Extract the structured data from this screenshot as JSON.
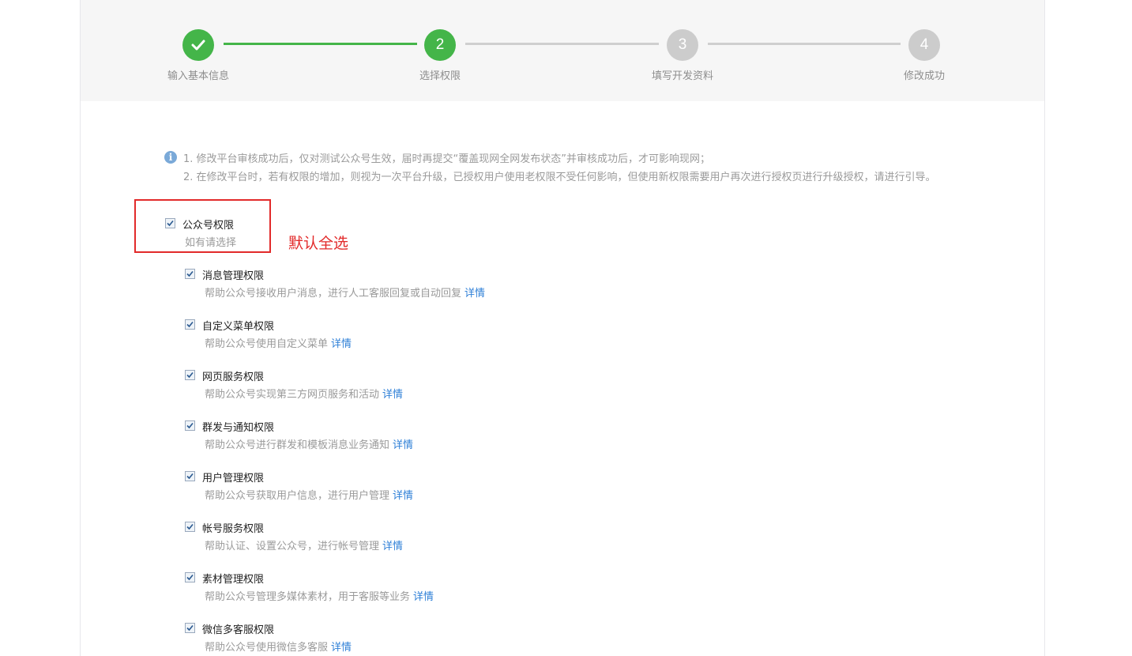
{
  "steps": [
    {
      "number": "1",
      "label": "输入基本信息",
      "state": "done"
    },
    {
      "number": "2",
      "label": "选择权限",
      "state": "current"
    },
    {
      "number": "3",
      "label": "填写开发资料",
      "state": "pending"
    },
    {
      "number": "4",
      "label": "修改成功",
      "state": "pending"
    }
  ],
  "notice": {
    "line1": "1. 修改平台审核成功后，仅对测试公众号生效，届时再提交“覆盖现网全网发布状态”并审核成功后，才可影响现网；",
    "line2": "2. 在修改平台时，若有权限的增加，则视为一次平台升级，已授权用户使用老权限不受任何影响，但使用新权限需要用户再次进行授权页进行升级授权，请进行引导。"
  },
  "group": {
    "title": "公众号权限",
    "subtitle": "如有请选择",
    "checked": true
  },
  "annotation": "默认全选",
  "permissions": [
    {
      "title": "消息管理权限",
      "desc": "帮助公众号接收用户消息，进行人工客服回复或自动回复",
      "link": "详情",
      "checked": true
    },
    {
      "title": "自定义菜单权限",
      "desc": "帮助公众号使用自定义菜单",
      "link": "详情",
      "checked": true
    },
    {
      "title": "网页服务权限",
      "desc": "帮助公众号实现第三方网页服务和活动",
      "link": "详情",
      "checked": true
    },
    {
      "title": "群发与通知权限",
      "desc": "帮助公众号进行群发和模板消息业务通知",
      "link": "详情",
      "checked": true
    },
    {
      "title": "用户管理权限",
      "desc": "帮助公众号获取用户信息，进行用户管理",
      "link": "详情",
      "checked": true
    },
    {
      "title": "帐号服务权限",
      "desc": "帮助认证、设置公众号，进行帐号管理",
      "link": "详情",
      "checked": true
    },
    {
      "title": "素材管理权限",
      "desc": "帮助公众号管理多媒体素材，用于客服等业务",
      "link": "详情",
      "checked": true
    },
    {
      "title": "微信多客服权限",
      "desc": "帮助公众号使用微信多客服",
      "link": "详情",
      "checked": true
    }
  ],
  "colors": {
    "step_active": "#44b549",
    "step_pending": "#cccccc",
    "link": "#2e7fd7",
    "annotation": "#e22a2a"
  }
}
